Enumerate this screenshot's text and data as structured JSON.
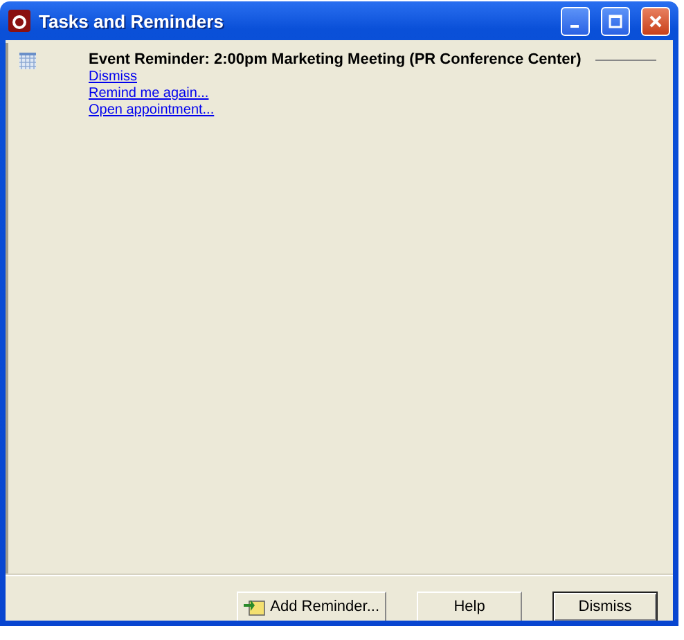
{
  "window": {
    "title": "Tasks and Reminders"
  },
  "reminders": [
    {
      "title": "Event Reminder: 2:00pm Marketing Meeting (PR Conference Center)",
      "links": [
        "Dismiss",
        "Remind me again...",
        "Open appointment..."
      ]
    }
  ],
  "buttons": [
    {
      "label": "Add Reminder...",
      "kind": "icon",
      "default": false
    },
    {
      "label": "Help",
      "kind": "plain",
      "default": false
    },
    {
      "label": "Dismiss",
      "kind": "plain",
      "default": true
    }
  ]
}
